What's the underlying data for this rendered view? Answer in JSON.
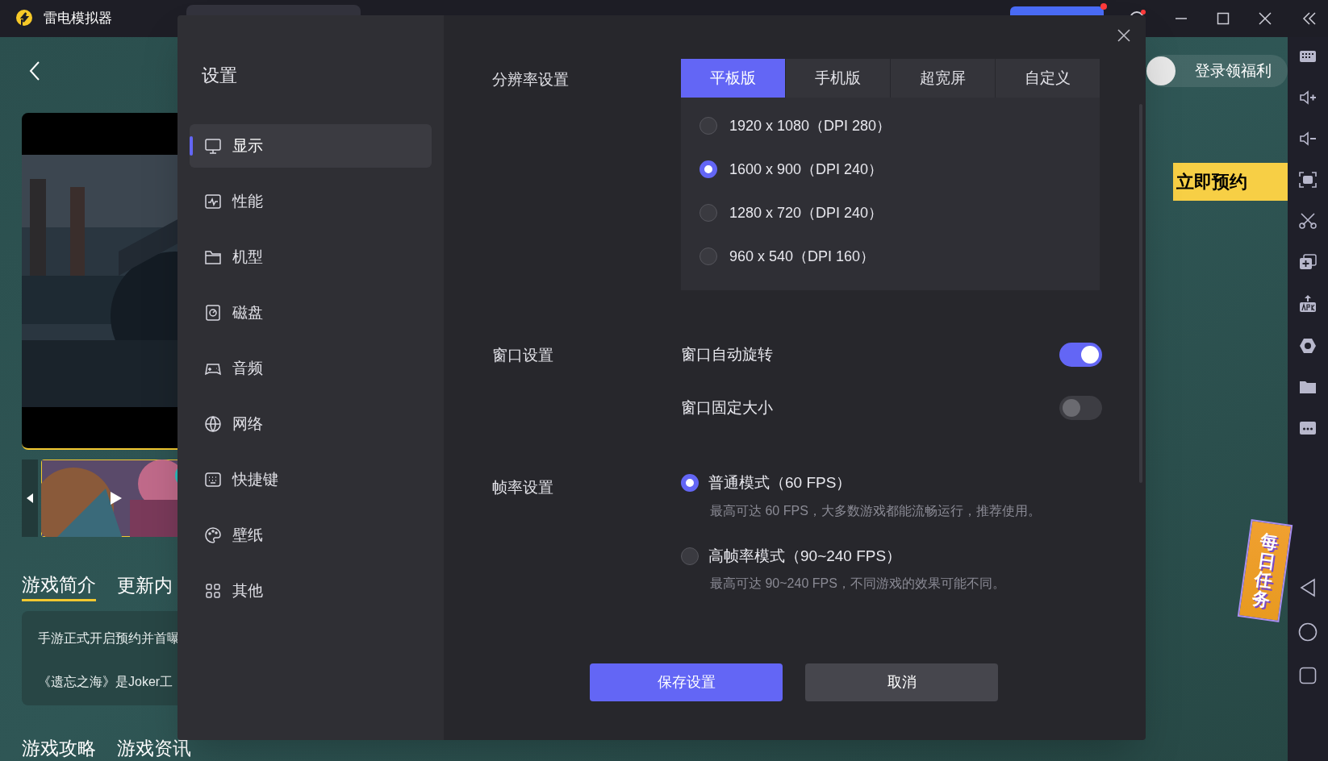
{
  "app": {
    "title": "雷电模拟器"
  },
  "background": {
    "tabs": [
      {
        "label": "游戏简介",
        "selected": true
      },
      {
        "label": "更新内",
        "selected": false
      }
    ],
    "intro_lines": [
      "手游正式开启预约并首曝",
      "《遗忘之海》是Joker工"
    ],
    "section_tabs": [
      "游戏攻略",
      "游戏资讯"
    ],
    "login_button": "登录领福利",
    "reserve_button": "立即预约",
    "daily_task": "每日任务"
  },
  "settings": {
    "title": "设置",
    "nav": [
      {
        "label": "显示",
        "kind": "monitor",
        "selected": true
      },
      {
        "label": "性能",
        "kind": "pulse",
        "selected": false
      },
      {
        "label": "机型",
        "kind": "folder",
        "selected": false
      },
      {
        "label": "磁盘",
        "kind": "disk",
        "selected": false
      },
      {
        "label": "音频",
        "kind": "gamepad",
        "selected": false
      },
      {
        "label": "网络",
        "kind": "globe",
        "selected": false
      },
      {
        "label": "快捷键",
        "kind": "keyboard",
        "selected": false
      },
      {
        "label": "壁纸",
        "kind": "palette",
        "selected": false
      },
      {
        "label": "其他",
        "kind": "grid",
        "selected": false
      }
    ],
    "resolution": {
      "label": "分辨率设置",
      "tabs": [
        {
          "label": "平板版",
          "selected": true
        },
        {
          "label": "手机版",
          "selected": false
        },
        {
          "label": "超宽屏",
          "selected": false
        },
        {
          "label": "自定义",
          "selected": false
        }
      ],
      "options": [
        {
          "label": "1920 x 1080（DPI 280）",
          "selected": false
        },
        {
          "label": "1600 x 900（DPI 240）",
          "selected": true
        },
        {
          "label": "1280 x 720（DPI 240）",
          "selected": false
        },
        {
          "label": "960 x 540（DPI 160）",
          "selected": false
        }
      ]
    },
    "window": {
      "label": "窗口设置",
      "toggles": [
        {
          "label": "窗口自动旋转",
          "on": true
        },
        {
          "label": "窗口固定大小",
          "on": false
        }
      ]
    },
    "frame_rate": {
      "label": "帧率设置",
      "options": [
        {
          "label": "普通模式（60 FPS）",
          "description": "最高可达 60 FPS，大多数游戏都能流畅运行，推荐使用。",
          "selected": true
        },
        {
          "label": "高帧率模式（90~240 FPS）",
          "description": "最高可达 90~240 FPS，不同游戏的效果可能不同。",
          "selected": false
        }
      ]
    },
    "buttons": {
      "save": "保存设置",
      "cancel": "取消"
    }
  }
}
